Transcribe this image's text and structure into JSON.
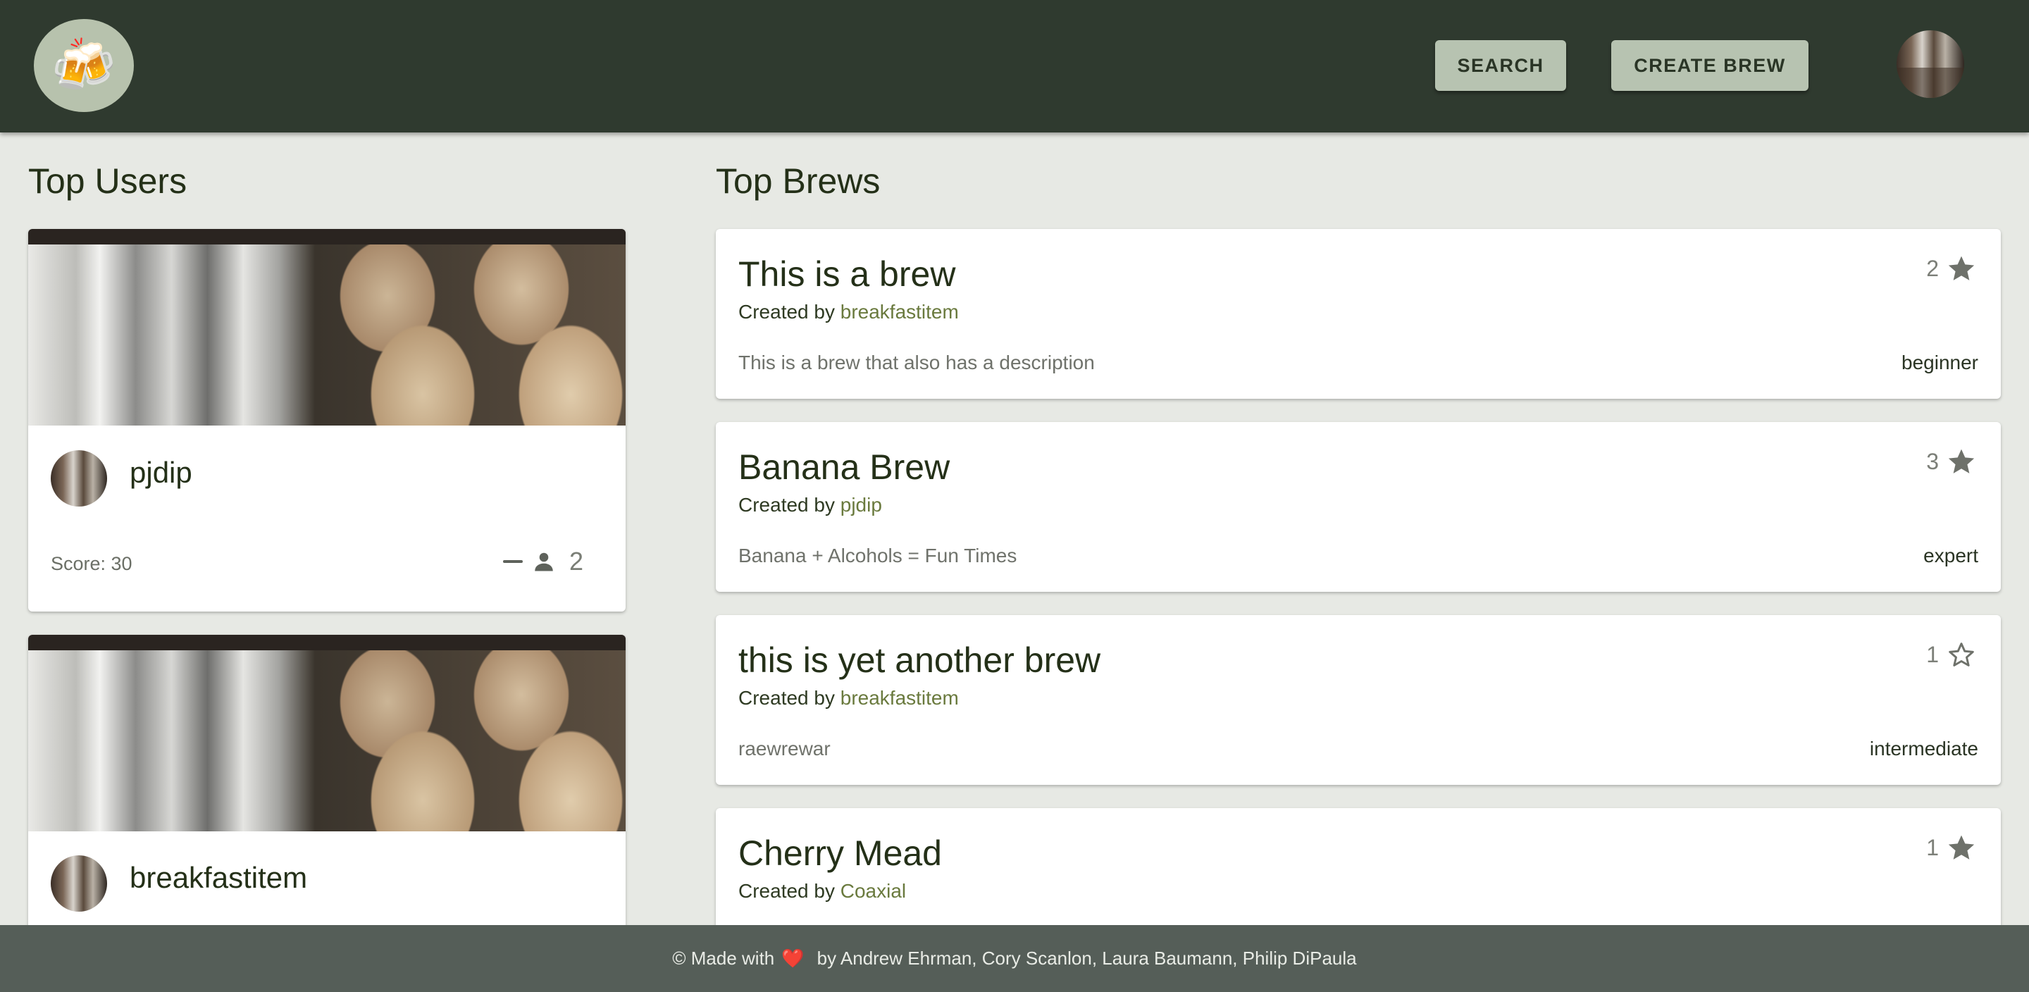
{
  "header": {
    "logo_icon": "beer-mugs-icon",
    "logo_glyph": "🍻",
    "search_label": "SEARCH",
    "create_label": "CREATE BREW"
  },
  "top_users": {
    "title": "Top Users",
    "users": [
      {
        "name": "pjdip",
        "score_label": "Score: 30",
        "followers": "2"
      },
      {
        "name": "breakfastitem"
      }
    ]
  },
  "top_brews": {
    "title": "Top Brews",
    "created_by_prefix": "Created by",
    "brews": [
      {
        "title": "This is a brew",
        "creator": "breakfastitem",
        "description": "This is a brew that also has a description",
        "level": "beginner",
        "rating": "2",
        "star": "filled"
      },
      {
        "title": "Banana Brew",
        "creator": "pjdip",
        "description": "Banana + Alcohols = Fun Times",
        "level": "expert",
        "rating": "3",
        "star": "filled"
      },
      {
        "title": "this is yet another brew",
        "creator": "breakfastitem",
        "description": "raewrewar",
        "level": "intermediate",
        "rating": "1",
        "star": "outline"
      },
      {
        "title": "Cherry Mead",
        "creator": "Coaxial",
        "rating": "1",
        "star": "filled"
      }
    ]
  },
  "footer": {
    "prefix": "© Made with",
    "heart": "❤️",
    "suffix": "by Andrew Ehrman, Cory Scanlon, Laura Baumann, Philip DiPaula"
  },
  "colors": {
    "header_bg": "#2f3a2f",
    "page_bg": "#e7e9e4",
    "button_bg": "#b7c3b1",
    "footer_bg": "#555e58",
    "link": "#6a7a3e"
  }
}
